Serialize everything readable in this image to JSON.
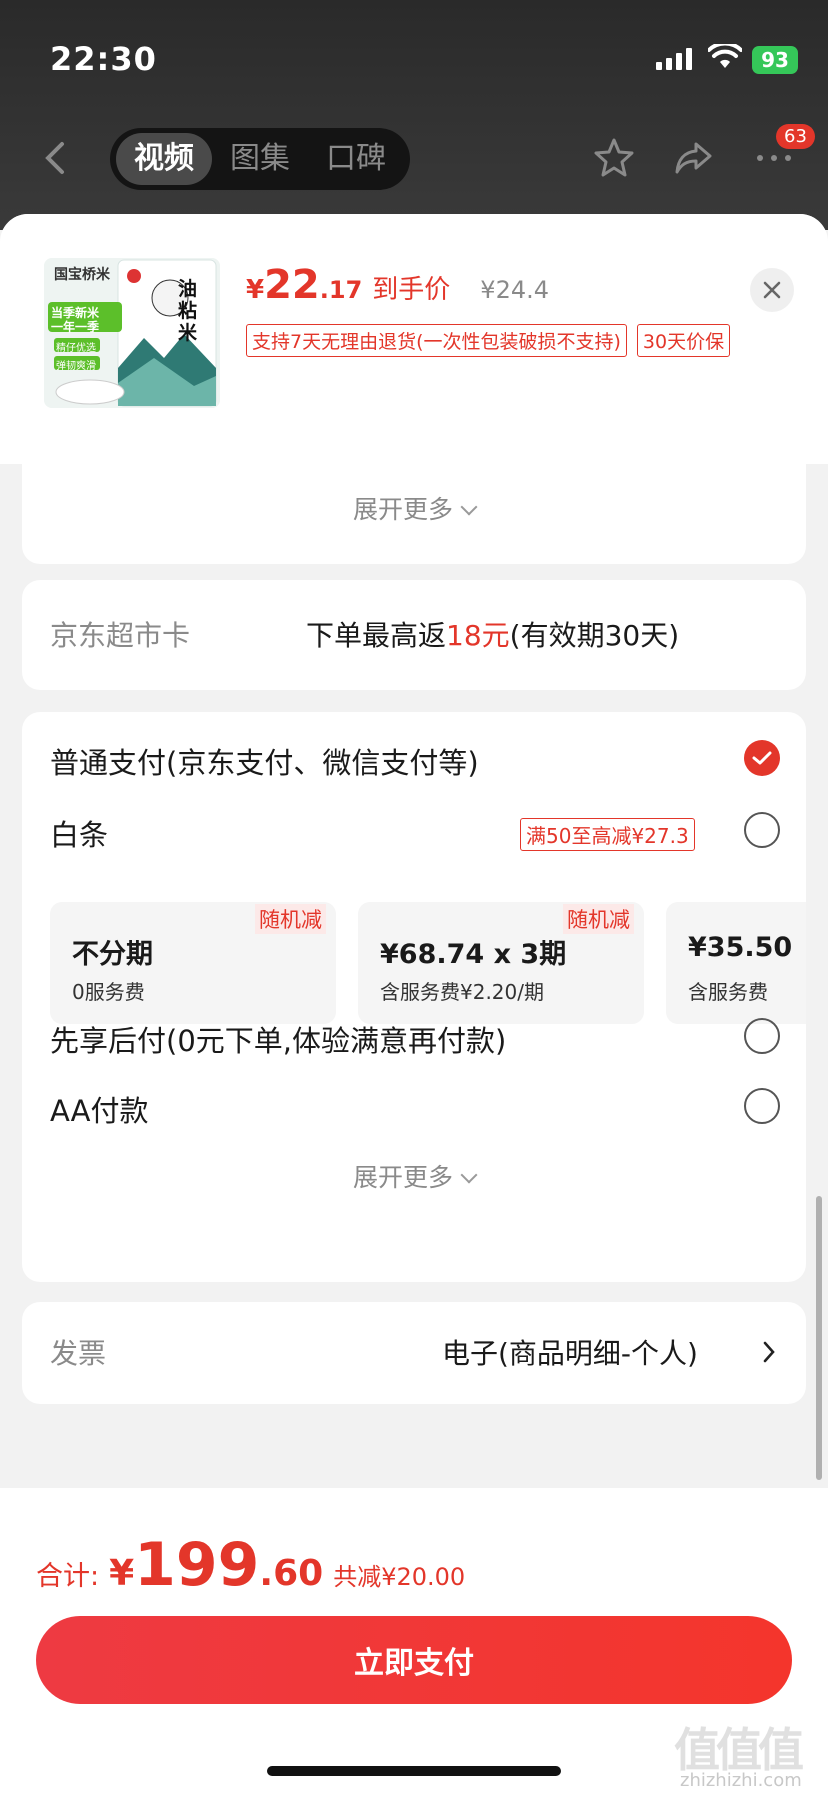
{
  "status_bar": {
    "time": "22:30",
    "battery": "93"
  },
  "nav": {
    "tabs": [
      {
        "label": "视频"
      },
      {
        "label": "图集"
      },
      {
        "label": "口碑"
      }
    ],
    "badge": "63",
    "icons": [
      "back-icon",
      "star-icon",
      "share-icon",
      "more-icon"
    ]
  },
  "product": {
    "price_symbol": "¥",
    "price_int": "22",
    "price_dec": ".17",
    "price_tag": "到手价",
    "original_price": "¥24.4",
    "tags": [
      "支持7天无理由退货(一次性包装破损不支持)",
      "30天价保"
    ],
    "image_texts": {
      "brand": "国宝桥米",
      "name": "油粘米",
      "promo1": "当季新米",
      "promo2": "一年一季",
      "chip1": "精仔优选",
      "chip2": "弹韧爽滑"
    }
  },
  "expand_label": "展开更多",
  "supermarket_card": {
    "label": "京东超市卡",
    "value_prefix": "下单最高返",
    "value_highlight": "18元",
    "value_suffix": "(有效期30天)"
  },
  "payment": {
    "normal": {
      "label": "普通支付(京东支付、微信支付等)",
      "checked": true
    },
    "baitiao": {
      "label": "白条",
      "promo": "满50至高减¥27.3",
      "checked": false
    },
    "installments": [
      {
        "badge": "随机减",
        "main": "不分期",
        "sub": "0服务费"
      },
      {
        "badge": "随机减",
        "main": "¥68.74 x 3期",
        "sub": "含服务费¥2.20/期"
      },
      {
        "badge": "",
        "main": "¥35.50",
        "sub": "含服务费"
      }
    ],
    "pay_later": {
      "label": "先享后付(0元下单,体验满意再付款)",
      "checked": false
    },
    "aa": {
      "label": "AA付款",
      "checked": false
    },
    "expand_label": "展开更多"
  },
  "invoice": {
    "label": "发票",
    "value": "电子(商品明细-个人)"
  },
  "footer": {
    "total_label": "合计:",
    "total_symbol": "¥",
    "total_int": "199",
    "total_dec": ".60",
    "total_save": "共减¥20.00",
    "pay_button": "立即支付"
  },
  "watermark": {
    "main": "值值值",
    "sub": "zhizhizhi.com"
  },
  "colors": {
    "accent": "#e3362a",
    "battery": "#35c759"
  }
}
